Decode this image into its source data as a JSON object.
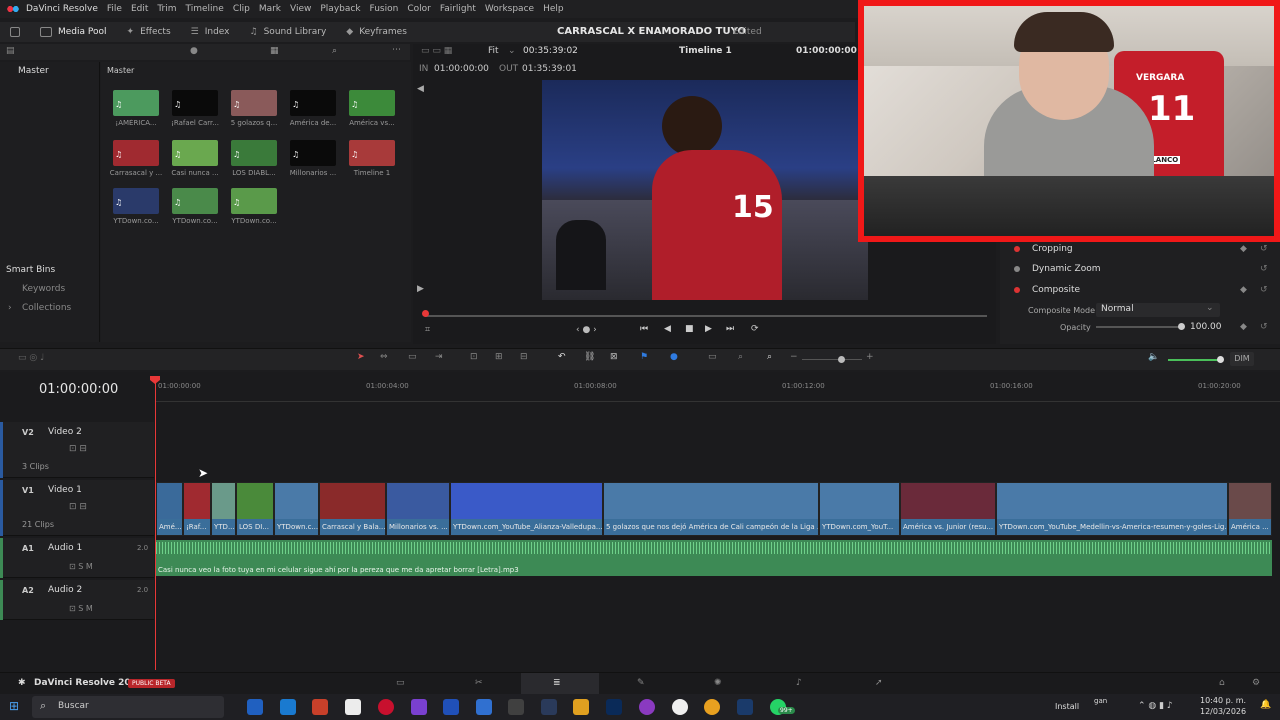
{
  "menubar": {
    "app_name": "DaVinci Resolve",
    "items": [
      "File",
      "Edit",
      "Trim",
      "Timeline",
      "Clip",
      "Mark",
      "View",
      "Playback",
      "Fusion",
      "Color",
      "Fairlight",
      "Workspace",
      "Help"
    ]
  },
  "toolbar": {
    "media_pool": "Media Pool",
    "effects": "Effects",
    "index": "Index",
    "sound_library": "Sound Library",
    "keyframes": "Keyframes"
  },
  "project": {
    "title": "CARRASCAL X ENAMORADO TUYO",
    "status": "Edited"
  },
  "viewer": {
    "fit": "Fit",
    "duration": "00:35:39:02",
    "timeline_name": "Timeline 1",
    "timecode": "01:00:00:00",
    "in_label": "IN",
    "in_tc": "01:00:00:00",
    "out_label": "OUT",
    "out_tc": "01:35:39:01"
  },
  "left_panel": {
    "master": "Master",
    "smart_bins": "Smart Bins",
    "keywords": "Keywords",
    "collections": "Collections"
  },
  "pool": {
    "header": "Master",
    "clips": [
      {
        "label": "¡AMÉRICA...",
        "color": "#4c9a5e"
      },
      {
        "label": "¡Rafael Carr...",
        "color": "#0a0a0a"
      },
      {
        "label": "5 golazos q...",
        "color": "#8a5a5a"
      },
      {
        "label": "América de...",
        "color": "#0a0a0a"
      },
      {
        "label": "América vs...",
        "color": "#3c8a3a"
      },
      {
        "label": "Carrasacal y ...",
        "color": "#a02a30"
      },
      {
        "label": "Casi nunca ...",
        "color": "#6aa84f"
      },
      {
        "label": "LOS DIABL...",
        "color": "#3a7a3a"
      },
      {
        "label": "Millonarios ...",
        "color": "#0a0a0a"
      },
      {
        "label": "Timeline 1",
        "color": "#a83a3a"
      },
      {
        "label": "YTDown.co...",
        "color": "#2a3a6a"
      },
      {
        "label": "YTDown.co...",
        "color": "#4a8a4a"
      },
      {
        "label": "YTDown.co...",
        "color": "#5a9a4a"
      }
    ]
  },
  "inspector": {
    "cropping": "Cropping",
    "dynamic_zoom": "Dynamic Zoom",
    "composite": "Composite",
    "composite_mode_label": "Composite Mode",
    "composite_mode_value": "Normal",
    "opacity_label": "Opacity",
    "opacity_value": "100.00"
  },
  "timeline": {
    "current_tc": "01:00:00:00",
    "ruler": [
      "01:00:00:00",
      "01:00:04:00",
      "01:00:08:00",
      "01:00:12:00",
      "01:00:16:00",
      "01:00:20:00"
    ],
    "dim": "DIM",
    "tracks": {
      "v2": {
        "id": "V2",
        "name": "Video 2",
        "clips": "3 Clips"
      },
      "v1": {
        "id": "V1",
        "name": "Video 1",
        "clips": "21 Clips"
      },
      "a1": {
        "id": "A1",
        "name": "Audio 1",
        "level": "2.0"
      },
      "a2": {
        "id": "A2",
        "name": "Audio 2",
        "level": "2.0"
      }
    },
    "video_clips": [
      {
        "label": "Amé...",
        "color": "#3a6a9a"
      },
      {
        "label": "¡Raf...",
        "color": "#a02a30"
      },
      {
        "label": "YTD...",
        "color": "#6a9a8a"
      },
      {
        "label": "LOS DI...",
        "color": "#4a8a3a"
      },
      {
        "label": "YTDown.c...",
        "color": "#4a7aa8"
      },
      {
        "label": "Carrascal y Bala...",
        "color": "#8a2a2a"
      },
      {
        "label": "Millonarios vs. ...",
        "color": "#3a5aa0"
      },
      {
        "label": "YTDown.com_YouTube_Alianza-Valledupa...",
        "color": "#3a5ac8"
      },
      {
        "label": "5 golazos que nos dejó América de Cali campeón de la Liga ...",
        "color": "#4a7aa8"
      },
      {
        "label": "YTDown.com_YouT...",
        "color": "#4a7aa8"
      },
      {
        "label": "América vs. Junior (resu...",
        "color": "#6a2a3a"
      },
      {
        "label": "YTDown.com_YouTube_Medellin-vs-America-resumen-y-goles-Lig...",
        "color": "#4a7aa8"
      },
      {
        "label": "América ...",
        "color": "#6a4a4a"
      }
    ],
    "audio_clip": "Casi nunca veo la foto tuya en mi celular sigue ahí por la pereza que me da apretar borrar  [Letra].mp3"
  },
  "statusbar": {
    "app": "DaVinci Resolve 20",
    "badge": "PUBLIC BETA"
  },
  "taskbar": {
    "search": "Buscar",
    "install": "Install",
    "time": "10:40 p. m.",
    "date": "12/03/2026",
    "badge": "99+",
    "lang": "gan"
  },
  "webcam_overlay": {
    "jersey_name": "VERGARA",
    "jersey_number": "11",
    "jersey_brand": "BLANCO"
  },
  "colors": {
    "accent_red": "#e83838",
    "audio_green": "#3d8a55",
    "webcam_border": "#f01818"
  }
}
